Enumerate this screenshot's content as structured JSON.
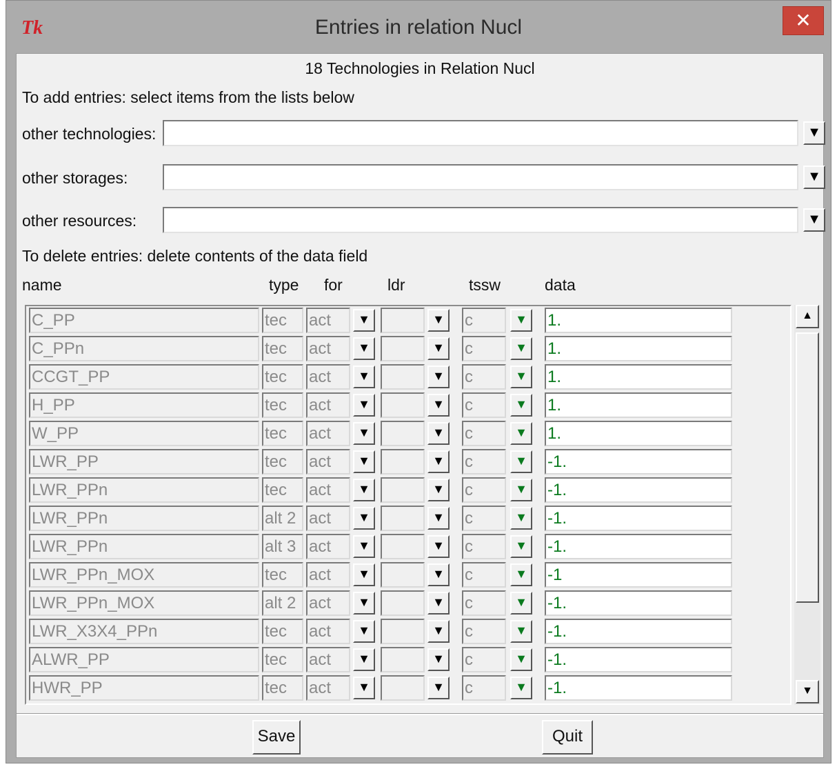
{
  "window": {
    "title": "Entries in relation Nucl",
    "logo_text": "Tk",
    "close_glyph": "✕"
  },
  "header": {
    "heading": "18 Technologies in Relation Nucl",
    "add_instruction": "To add entries: select items from the lists below",
    "delete_instruction": "To delete entries: delete contents of the data field"
  },
  "selectors": {
    "other_technologies_label": "other technologies:",
    "other_storages_label": "other storages:",
    "other_resources_label": "other resources:",
    "other_technologies_value": "",
    "other_storages_value": "",
    "other_resources_value": ""
  },
  "columns": {
    "name": "name",
    "type": "type",
    "for": "for",
    "ldr": "ldr",
    "tssw": "tssw",
    "data": "data"
  },
  "rows": [
    {
      "name": "C_PP",
      "type": "tec",
      "for": "act",
      "ldr": "",
      "tssw": "c",
      "data": "1."
    },
    {
      "name": "C_PPn",
      "type": "tec",
      "for": "act",
      "ldr": "",
      "tssw": "c",
      "data": "1."
    },
    {
      "name": "CCGT_PP",
      "type": "tec",
      "for": "act",
      "ldr": "",
      "tssw": "c",
      "data": "1."
    },
    {
      "name": "H_PP",
      "type": "tec",
      "for": "act",
      "ldr": "",
      "tssw": "c",
      "data": "1."
    },
    {
      "name": "W_PP",
      "type": "tec",
      "for": "act",
      "ldr": "",
      "tssw": "c",
      "data": "1."
    },
    {
      "name": "LWR_PP",
      "type": "tec",
      "for": "act",
      "ldr": "",
      "tssw": "c",
      "data": "-1."
    },
    {
      "name": "LWR_PPn",
      "type": "tec",
      "for": "act",
      "ldr": "",
      "tssw": "c",
      "data": "-1."
    },
    {
      "name": "LWR_PPn",
      "type": "alt 2",
      "for": "act",
      "ldr": "",
      "tssw": "c",
      "data": "-1."
    },
    {
      "name": "LWR_PPn",
      "type": "alt 3",
      "for": "act",
      "ldr": "",
      "tssw": "c",
      "data": "-1."
    },
    {
      "name": "LWR_PPn_MOX",
      "type": "tec",
      "for": "act",
      "ldr": "",
      "tssw": "c",
      "data": "-1"
    },
    {
      "name": "LWR_PPn_MOX",
      "type": "alt 2",
      "for": "act",
      "ldr": "",
      "tssw": "c",
      "data": "-1."
    },
    {
      "name": "LWR_X3X4_PPn",
      "type": "tec",
      "for": "act",
      "ldr": "",
      "tssw": "c",
      "data": "-1."
    },
    {
      "name": "ALWR_PP",
      "type": "tec",
      "for": "act",
      "ldr": "",
      "tssw": "c",
      "data": "-1."
    },
    {
      "name": "HWR_PP",
      "type": "tec",
      "for": "act",
      "ldr": "",
      "tssw": "c",
      "data": "-1."
    }
  ],
  "icons": {
    "dropdown_arrow": "▼",
    "scroll_up": "▲",
    "scroll_down": "▼"
  },
  "colors": {
    "data_text": "#0a7a1e",
    "close_button": "#c9453a"
  },
  "buttons": {
    "save": "Save",
    "quit": "Quit"
  }
}
